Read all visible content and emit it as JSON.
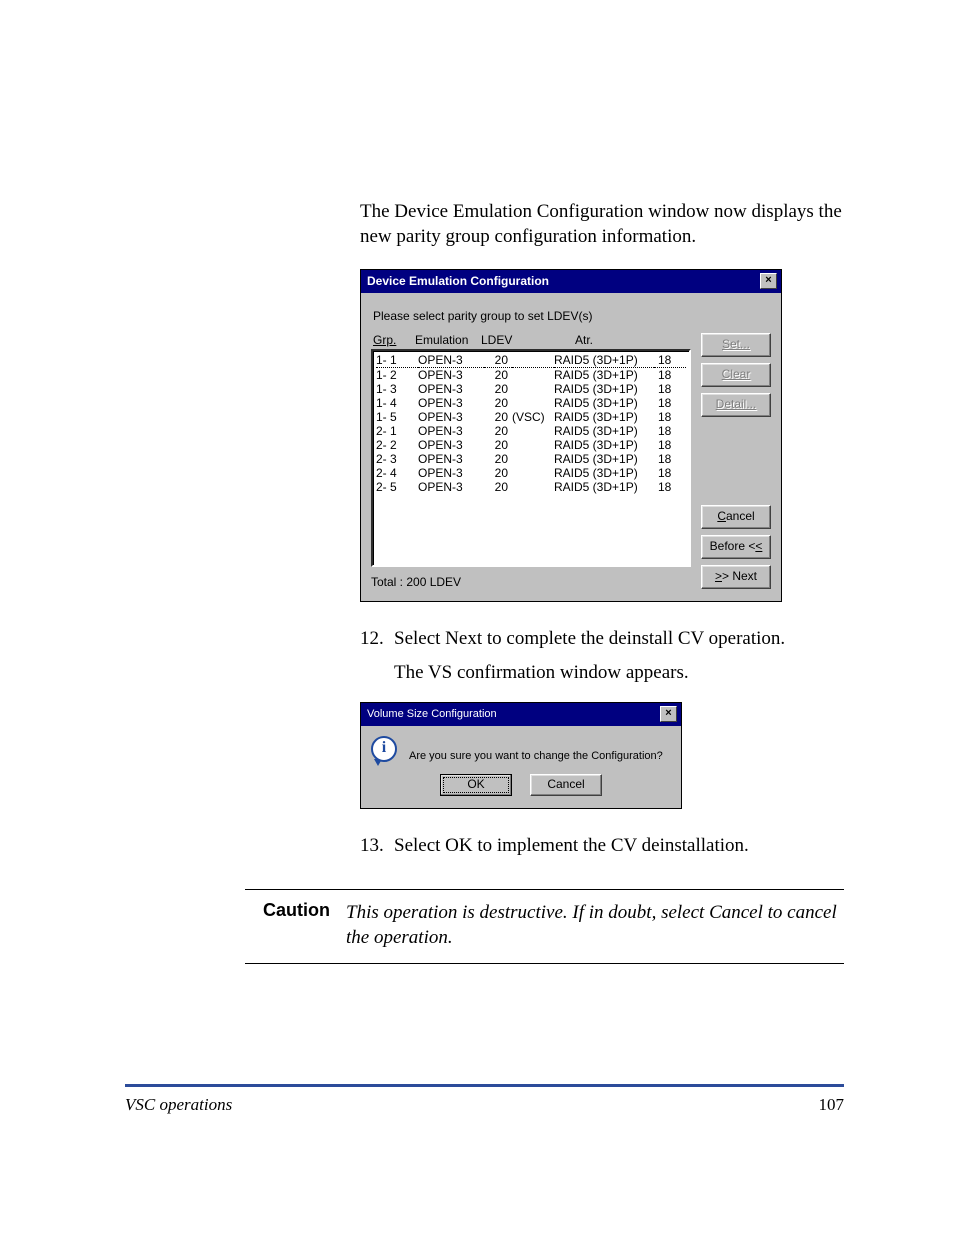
{
  "intro": "The Device Emulation Configuration window now displays the new parity group configuration information.",
  "dec": {
    "title": "Device Emulation Configuration",
    "instruction": "Please select parity group to set LDEV(s)",
    "headers": {
      "grp": "Grp.",
      "emulation": "Emulation",
      "ldev": "LDEV",
      "atr": "Atr."
    },
    "rows": [
      {
        "grp": "1- 1",
        "emu": "OPEN-3",
        "ldev": "20",
        "extra": "",
        "atr": "RAID5 (3D+1P)",
        "num": "18"
      },
      {
        "grp": "1- 2",
        "emu": "OPEN-3",
        "ldev": "20",
        "extra": "",
        "atr": "RAID5 (3D+1P)",
        "num": "18"
      },
      {
        "grp": "1- 3",
        "emu": "OPEN-3",
        "ldev": "20",
        "extra": "",
        "atr": "RAID5 (3D+1P)",
        "num": "18"
      },
      {
        "grp": "1- 4",
        "emu": "OPEN-3",
        "ldev": "20",
        "extra": "",
        "atr": "RAID5 (3D+1P)",
        "num": "18"
      },
      {
        "grp": "1- 5",
        "emu": "OPEN-3",
        "ldev": "20",
        "extra": "(VSC)",
        "atr": "RAID5 (3D+1P)",
        "num": "18"
      },
      {
        "grp": "2- 1",
        "emu": "OPEN-3",
        "ldev": "20",
        "extra": "",
        "atr": "RAID5 (3D+1P)",
        "num": "18"
      },
      {
        "grp": "2- 2",
        "emu": "OPEN-3",
        "ldev": "20",
        "extra": "",
        "atr": "RAID5 (3D+1P)",
        "num": "18"
      },
      {
        "grp": "2- 3",
        "emu": "OPEN-3",
        "ldev": "20",
        "extra": "",
        "atr": "RAID5 (3D+1P)",
        "num": "18"
      },
      {
        "grp": "2- 4",
        "emu": "OPEN-3",
        "ldev": "20",
        "extra": "",
        "atr": "RAID5 (3D+1P)",
        "num": "18"
      },
      {
        "grp": "2- 5",
        "emu": "OPEN-3",
        "ldev": "20",
        "extra": "",
        "atr": "RAID5 (3D+1P)",
        "num": "18"
      }
    ],
    "total": "Total : 200 LDEV",
    "buttons": {
      "set": "Set...",
      "clear": "Clear",
      "detail": "Detail...",
      "cancel": "Cancel",
      "before": "Before <<",
      "next": ">> Next"
    }
  },
  "step12": {
    "num": "12.",
    "text": "Select Next to complete the deinstall CV operation."
  },
  "step12sub": "The VS confirmation window appears.",
  "vs": {
    "title": "Volume Size Configuration",
    "message": "Are you sure you want to change the Configuration?",
    "ok": "OK",
    "cancel": "Cancel"
  },
  "step13": {
    "num": "13.",
    "text": "Select OK to implement the CV deinstallation."
  },
  "caution": {
    "label": "Caution",
    "text": "This operation is destructive. If in doubt, select Cancel to cancel the operation."
  },
  "footer": {
    "left": "VSC operations",
    "right": "107"
  }
}
